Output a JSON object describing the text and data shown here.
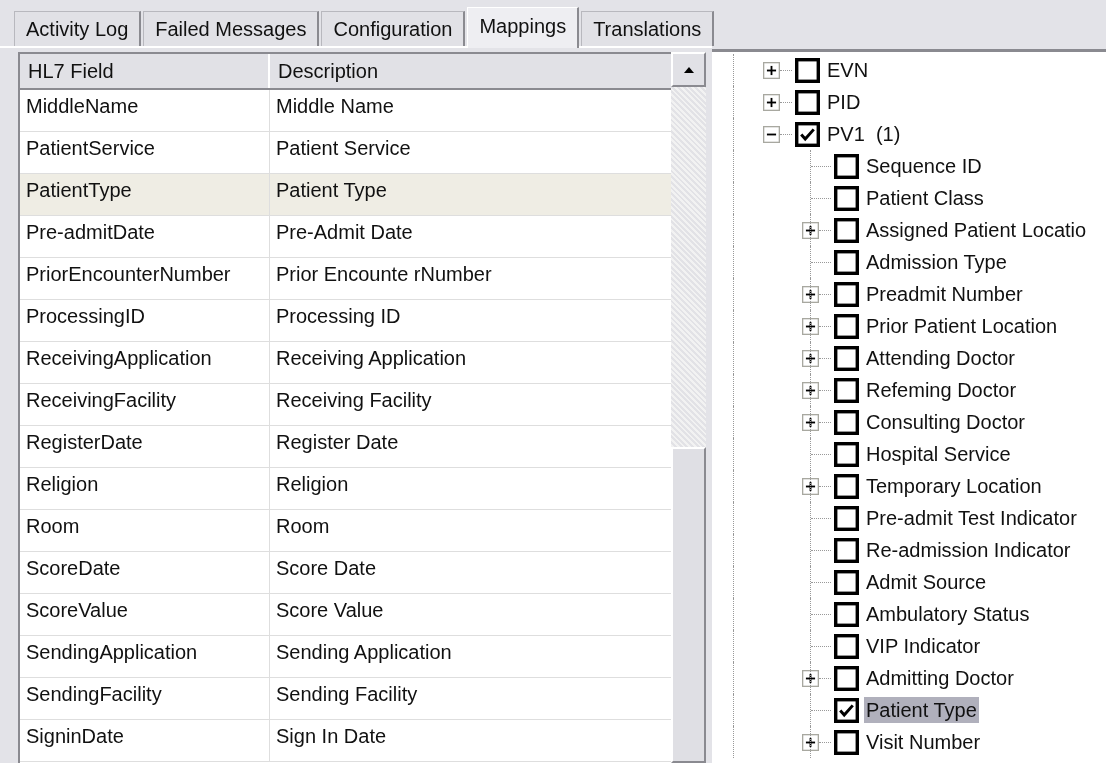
{
  "tabs": [
    {
      "label": "Activity Log",
      "selected": false
    },
    {
      "label": "Failed Messages",
      "selected": false
    },
    {
      "label": "Configuration",
      "selected": false
    },
    {
      "label": "Mappings",
      "selected": true
    },
    {
      "label": "Translations",
      "selected": false
    }
  ],
  "grid": {
    "columns": [
      "HL7 Field",
      "Description"
    ],
    "rows": [
      {
        "field": "MiddleName",
        "description": "Middle Name",
        "selected": false
      },
      {
        "field": "PatientService",
        "description": "Patient Service",
        "selected": false
      },
      {
        "field": "PatientType",
        "description": "Patient Type",
        "selected": true
      },
      {
        "field": "Pre-admitDate",
        "description": "Pre-Admit Date",
        "selected": false
      },
      {
        "field": "PriorEncounterNumber",
        "description": "Prior Encounte rNumber",
        "selected": false
      },
      {
        "field": "ProcessingID",
        "description": "Processing ID",
        "selected": false
      },
      {
        "field": "ReceivingApplication",
        "description": "Receiving Application",
        "selected": false
      },
      {
        "field": "ReceivingFacility",
        "description": "Receiving Facility",
        "selected": false
      },
      {
        "field": "RegisterDate",
        "description": "Register Date",
        "selected": false
      },
      {
        "field": "Religion",
        "description": "Religion",
        "selected": false
      },
      {
        "field": "Room",
        "description": "Room",
        "selected": false
      },
      {
        "field": "ScoreDate",
        "description": "Score Date",
        "selected": false
      },
      {
        "field": "ScoreValue",
        "description": "Score Value",
        "selected": false
      },
      {
        "field": "SendingApplication",
        "description": "Sending Application",
        "selected": false
      },
      {
        "field": "SendingFacility",
        "description": "Sending Facility",
        "selected": false
      },
      {
        "field": "SigninDate",
        "description": "Sign In Date",
        "selected": false
      }
    ]
  },
  "tree": {
    "items": [
      {
        "label": "EVN",
        "kind": "group",
        "expanded": false,
        "checked": false,
        "selected": false
      },
      {
        "label": "PID",
        "kind": "group",
        "expanded": false,
        "checked": false,
        "selected": false
      },
      {
        "label": "PV1  (1)",
        "kind": "group",
        "expanded": true,
        "checked": true,
        "selected": false,
        "children": [
          {
            "label": "Sequence ID",
            "kind": "leaf",
            "expanded": false,
            "checked": false,
            "selected": false
          },
          {
            "label": "Patient Class",
            "kind": "leaf",
            "expanded": false,
            "checked": false,
            "selected": false
          },
          {
            "label": "Assigned Patient Locatio",
            "kind": "group",
            "expanded": false,
            "checked": false,
            "selected": false
          },
          {
            "label": "Admission Type",
            "kind": "leaf",
            "expanded": false,
            "checked": false,
            "selected": false
          },
          {
            "label": "Preadmit Number",
            "kind": "group",
            "expanded": false,
            "checked": false,
            "selected": false
          },
          {
            "label": "Prior Patient Location",
            "kind": "group",
            "expanded": false,
            "checked": false,
            "selected": false
          },
          {
            "label": "Attending Doctor",
            "kind": "group",
            "expanded": false,
            "checked": false,
            "selected": false
          },
          {
            "label": "Refeming Doctor",
            "kind": "group",
            "expanded": false,
            "checked": false,
            "selected": false
          },
          {
            "label": "Consulting Doctor",
            "kind": "group",
            "expanded": false,
            "checked": false,
            "selected": false
          },
          {
            "label": "Hospital Service",
            "kind": "leaf",
            "expanded": false,
            "checked": false,
            "selected": false
          },
          {
            "label": "Temporary Location",
            "kind": "group",
            "expanded": false,
            "checked": false,
            "selected": false
          },
          {
            "label": "Pre-admit Test Indicator",
            "kind": "leaf",
            "expanded": false,
            "checked": false,
            "selected": false
          },
          {
            "label": "Re-admission Indicator",
            "kind": "leaf",
            "expanded": false,
            "checked": false,
            "selected": false
          },
          {
            "label": "Admit Source",
            "kind": "leaf",
            "expanded": false,
            "checked": false,
            "selected": false
          },
          {
            "label": "Ambulatory Status",
            "kind": "leaf",
            "expanded": false,
            "checked": false,
            "selected": false
          },
          {
            "label": "VIP Indicator",
            "kind": "leaf",
            "expanded": false,
            "checked": false,
            "selected": false
          },
          {
            "label": "Admitting Doctor",
            "kind": "group",
            "expanded": false,
            "checked": false,
            "selected": false
          },
          {
            "label": "Patient Type",
            "kind": "leaf",
            "expanded": false,
            "checked": true,
            "selected": true
          },
          {
            "label": "Visit Number",
            "kind": "group",
            "expanded": false,
            "checked": false,
            "selected": false
          }
        ]
      }
    ]
  }
}
